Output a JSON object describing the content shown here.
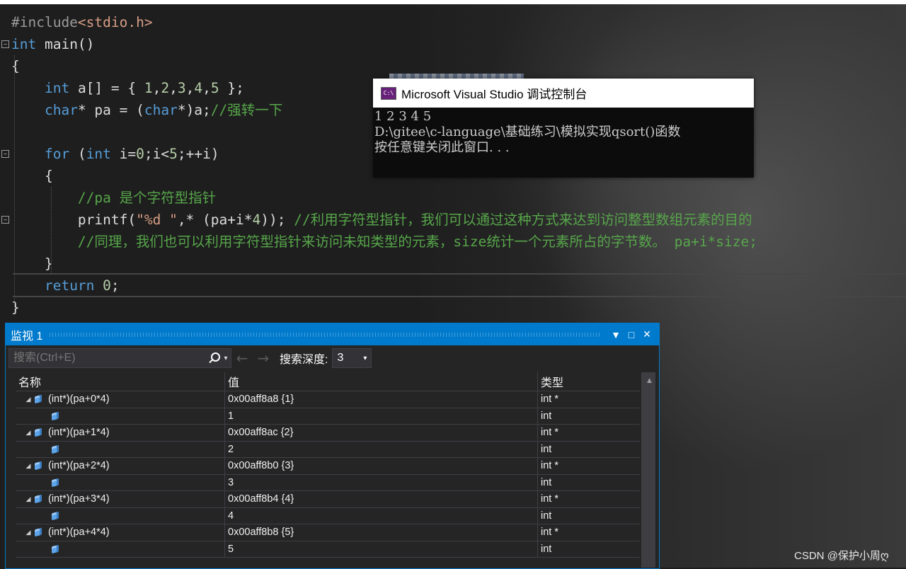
{
  "editor": {
    "lines": [
      {
        "html": "<span class='pp'>#include</span><span class='inc'>&lt;stdio.h&gt;</span>"
      },
      {
        "html": "<span class='kw'>int</span> main()"
      },
      {
        "html": "{"
      },
      {
        "html": "    <span class='kw'>int</span> a[] = { <span class='nm'>1</span>,<span class='nm'>2</span>,<span class='nm'>3</span>,<span class='nm'>4</span>,<span class='nm'>5</span> };"
      },
      {
        "html": "    <span class='kw'>char</span>* pa = (<span class='kw'>char</span>*)a;<span class='cm'>//强转一下</span>"
      },
      {
        "html": ""
      },
      {
        "html": "    <span class='kw'>for</span> (<span class='kw'>int</span> i=<span class='nm'>0</span>;i&lt;<span class='nm'>5</span>;++i)"
      },
      {
        "html": "    {"
      },
      {
        "html": "        <span class='cm'>//pa 是个字符型指针</span>"
      },
      {
        "html": "        printf(<span class='st'>\"%d \"</span>,* (pa+i*<span class='nm'>4</span>)); <span class='cm'>//利用字符型指针，我们可以通过这种方式来达到访问整型数组元素的目的</span>"
      },
      {
        "html": "        <span class='cm'>//同理，我们也可以利用字符型指针来访问未知类型的元素，size统计一个元素所占的字节数。 pa+i*size;</span>"
      },
      {
        "html": "    }"
      },
      {
        "html": "    <span class='kw'>return</span> <span class='nm'>0</span>;"
      },
      {
        "html": "}"
      }
    ]
  },
  "console": {
    "title": "Microsoft Visual Studio 调试控制台",
    "icon": "C:\\",
    "output": [
      "1 2 3 4 5",
      "D:\\gitee\\c-language\\基础练习\\模拟实现qsort()函数",
      "按任意键关闭此窗口. . ."
    ]
  },
  "watch": {
    "title": "监视 1",
    "search_placeholder": "搜索(Ctrl+E)",
    "depth_label": "搜索深度:",
    "depth_value": "3",
    "columns": {
      "name": "名称",
      "value": "值",
      "type": "类型"
    },
    "rows": [
      {
        "name": "(int*)(pa+0*4)",
        "value": "0x00aff8a8 {1}",
        "type": "int *",
        "parent": true
      },
      {
        "name": "",
        "value": "1",
        "type": "int",
        "parent": false
      },
      {
        "name": "(int*)(pa+1*4)",
        "value": "0x00aff8ac {2}",
        "type": "int *",
        "parent": true
      },
      {
        "name": "",
        "value": "2",
        "type": "int",
        "parent": false
      },
      {
        "name": "(int*)(pa+2*4)",
        "value": "0x00aff8b0 {3}",
        "type": "int *",
        "parent": true
      },
      {
        "name": "",
        "value": "3",
        "type": "int",
        "parent": false
      },
      {
        "name": "(int*)(pa+3*4)",
        "value": "0x00aff8b4 {4}",
        "type": "int *",
        "parent": true
      },
      {
        "name": "",
        "value": "4",
        "type": "int",
        "parent": false
      },
      {
        "name": "(int*)(pa+4*4)",
        "value": "0x00aff8b8 {5}",
        "type": "int *",
        "parent": true
      },
      {
        "name": "",
        "value": "5",
        "type": "int",
        "parent": false
      }
    ]
  },
  "watermark": "CSDN @保护小周ღ",
  "colors": {
    "accent": "#007acc",
    "keyword": "#569cd6",
    "comment": "#57a64a",
    "string": "#d69d85",
    "number": "#b5cea8"
  }
}
